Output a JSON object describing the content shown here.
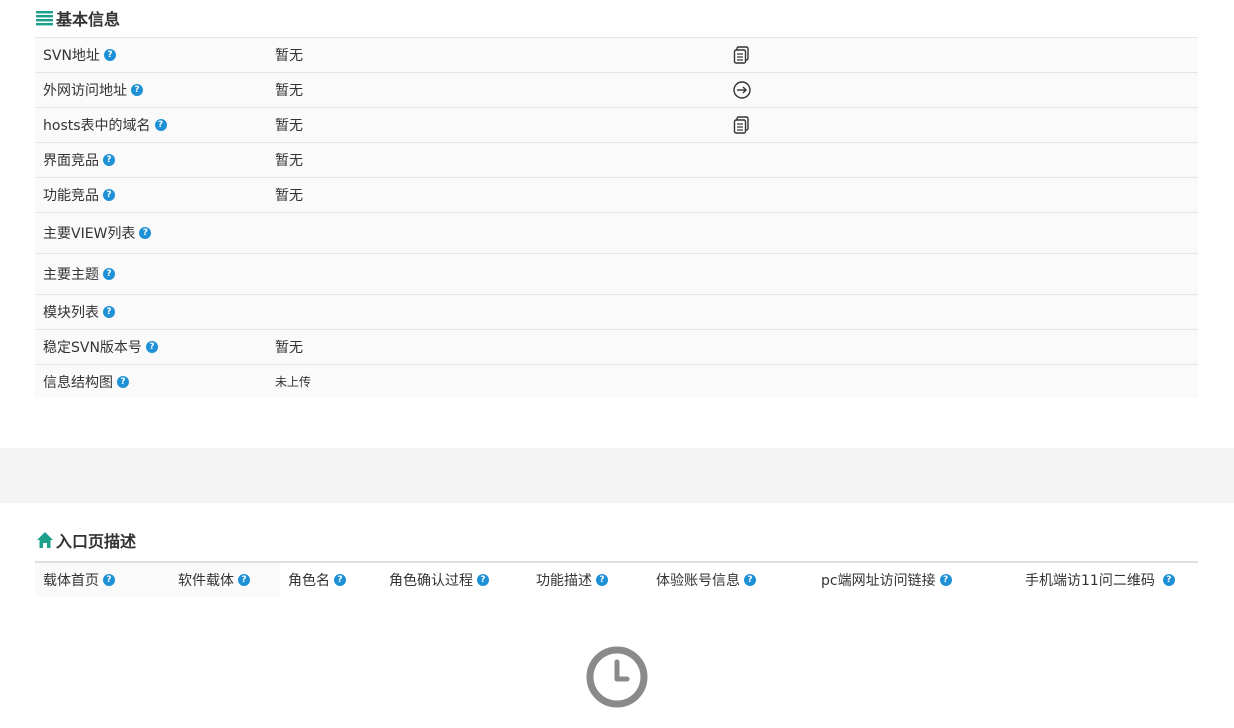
{
  "basic_info": {
    "title": "基本信息",
    "rows": [
      {
        "label": "SVN地址",
        "value": "暂无",
        "action": "copy"
      },
      {
        "label": "外网访问地址",
        "value": "暂无",
        "action": "goto"
      },
      {
        "label": "hosts表中的域名",
        "value": "暂无",
        "action": "copy"
      },
      {
        "label": "界面竞品",
        "value": "暂无"
      },
      {
        "label": "功能竞品",
        "value": "暂无"
      },
      {
        "label": "主要VIEW列表",
        "value": ""
      },
      {
        "label": "主要主题",
        "value": ""
      },
      {
        "label": "模块列表",
        "value": ""
      },
      {
        "label": "稳定SVN版本号",
        "value": "暂无"
      },
      {
        "label": "信息结构图",
        "value": "未上传"
      }
    ]
  },
  "entry_desc": {
    "title": "入口页描述",
    "columns": [
      "载体首页",
      "软件载体",
      "角色名",
      "角色确认过程",
      "功能描述",
      "体验账号信息",
      "pc端网址访问链接",
      "手机端访11问二维码"
    ]
  },
  "colors": {
    "accent": "#1aa08c",
    "help": "#1e90d6",
    "row_bg": "#fafafa",
    "border": "#e6e6e6"
  },
  "help_glyph": "?",
  "icons": {
    "list": "list-icon",
    "home": "home-icon",
    "copy": "copy-icon",
    "goto": "arrow-circle-icon",
    "loading": "clock-icon"
  }
}
